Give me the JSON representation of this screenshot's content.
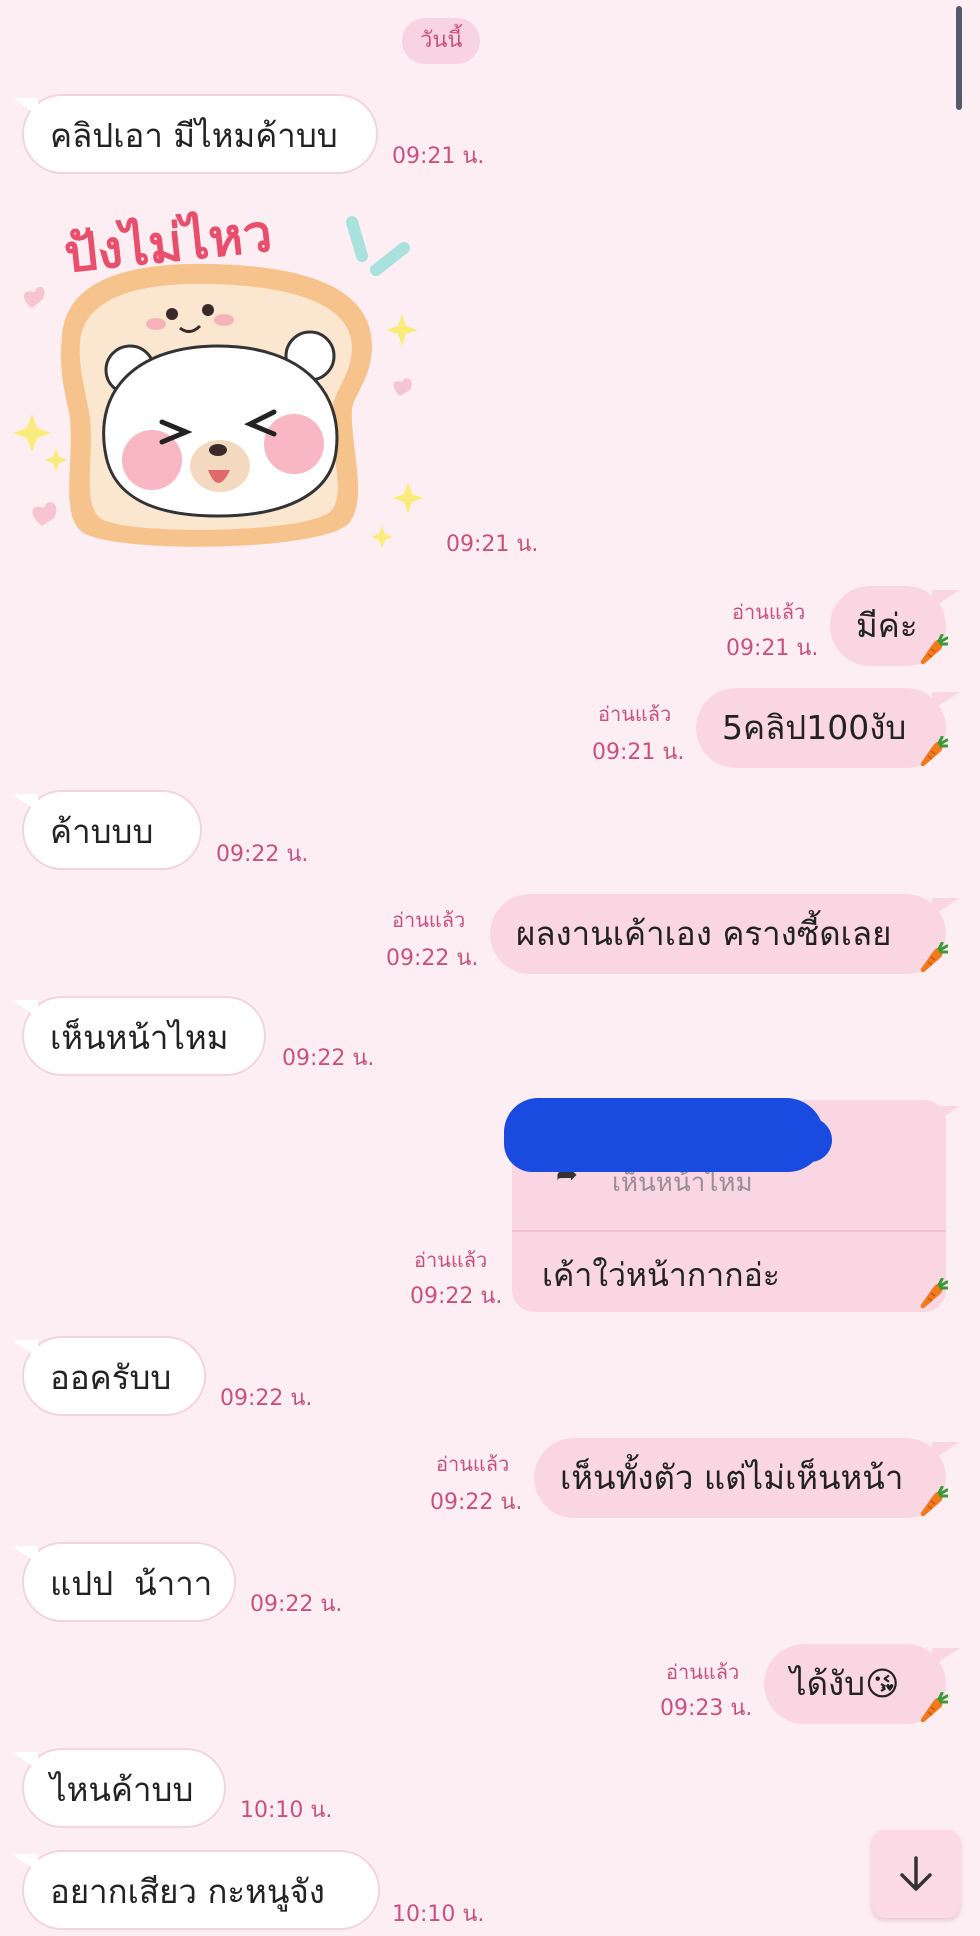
{
  "date_label": "วันนี้",
  "sticker": {
    "caption": "ปังไม่ไหว",
    "time": "09:21 น."
  },
  "messages": [
    {
      "dir": "in",
      "text": "คลิปเอา มีไหมค้าบบ",
      "time": "09:21 น."
    },
    {
      "dir": "out",
      "text": "มีค่ะ",
      "time": "09:21 น.",
      "read": "อ่านแล้ว"
    },
    {
      "dir": "out",
      "text": "5คลิป100งับ",
      "time": "09:21 น.",
      "read": "อ่านแล้ว"
    },
    {
      "dir": "in",
      "text": "ค้าบบบ",
      "time": "09:22 น."
    },
    {
      "dir": "out",
      "text": "ผลงานเค้าเอง ครางซี้ดเลย",
      "time": "09:22 น.",
      "read": "อ่านแล้ว"
    },
    {
      "dir": "in",
      "text": "เห็นหน้าไหม",
      "time": "09:22 น."
    },
    {
      "dir": "out",
      "text": "เค้าใว่หน้ากากอ่ะ",
      "time": "09:22 น.",
      "read": "อ่านแล้ว",
      "reply_to": "เห็นหน้าไหม"
    },
    {
      "dir": "in",
      "text": "ออครับบ",
      "time": "09:22 น."
    },
    {
      "dir": "out",
      "text": "เห็นทั้งตัว แต่ไม่เห็นหน้า",
      "time": "09:22 น.",
      "read": "อ่านแล้ว"
    },
    {
      "dir": "in",
      "text": "แปป  น้าาา",
      "time": "09:22 น."
    },
    {
      "dir": "out",
      "text": "ได้งับ",
      "emoji": "😘",
      "time": "09:23 น.",
      "read": "อ่านแล้ว"
    },
    {
      "dir": "in",
      "text": "ไหนค้าบบ",
      "time": "10:10 น."
    },
    {
      "dir": "in",
      "text": "อยากเสียว กะหนูจัง",
      "time": "10:10 น."
    }
  ],
  "icons": {
    "carrot": "carrot-icon",
    "scroll_down": "arrow-down-icon"
  },
  "colors": {
    "background": "#fdeef4",
    "outgoing_bubble": "#fad6e3",
    "incoming_bubble": "#ffffff",
    "meta_text": "#c8527e"
  }
}
